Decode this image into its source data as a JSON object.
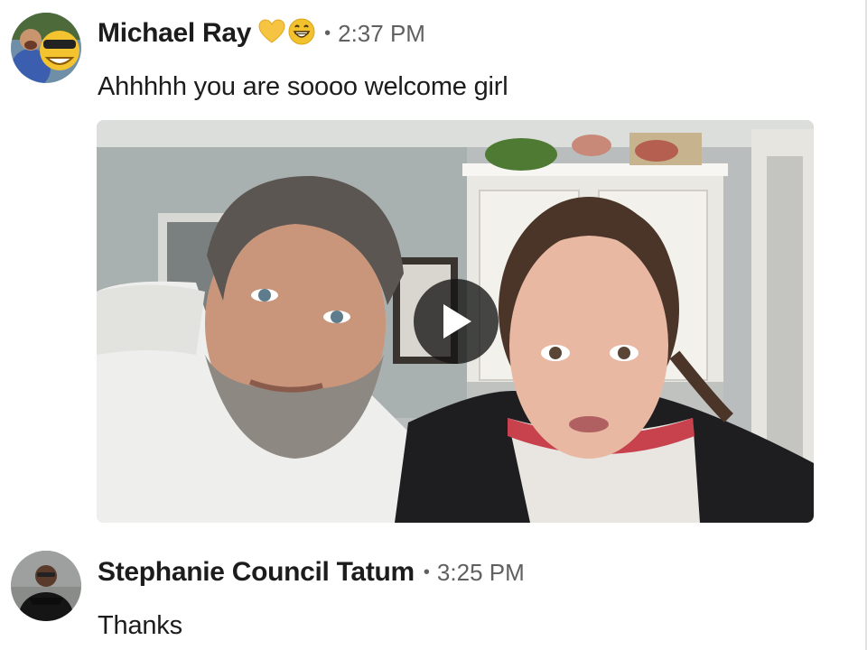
{
  "messages": [
    {
      "author": "Michael Ray",
      "separator": "•",
      "time": "2:37 PM",
      "text": "Ahhhhh you are soooo welcome girl",
      "status_icons": [
        "yellow-heart-icon",
        "grinning-face-icon"
      ],
      "attachment": {
        "type": "video",
        "action_icon": "play-icon"
      }
    },
    {
      "author": "Stephanie Council Tatum",
      "separator": "•",
      "time": "3:25 PM",
      "text": "Thanks"
    }
  ],
  "colors": {
    "text": "#1d1c1d",
    "timestamp": "#616061",
    "heart": "#f6c342",
    "grin": "#f2c12e"
  }
}
